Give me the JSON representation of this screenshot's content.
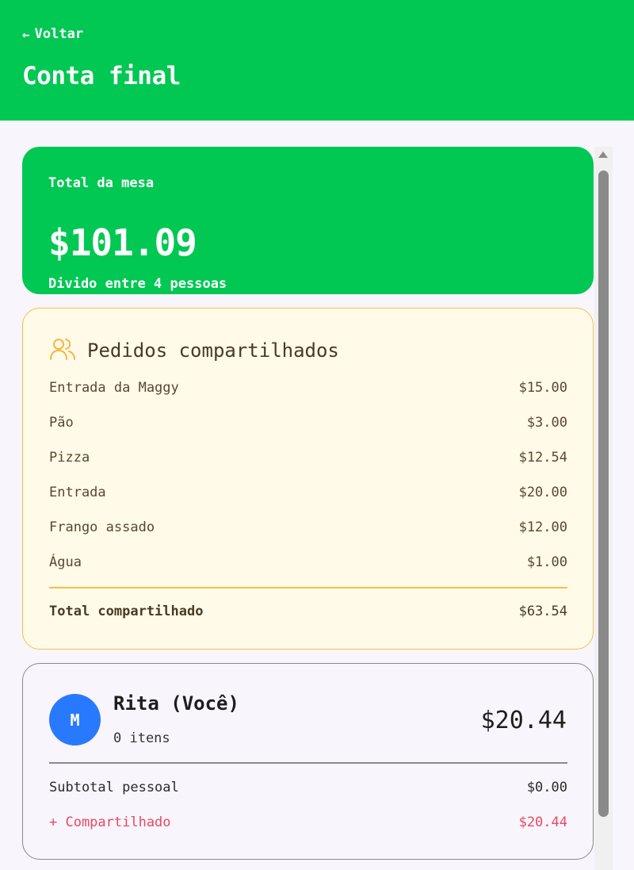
{
  "header": {
    "back_label": "Voltar",
    "title": "Conta final"
  },
  "table_total": {
    "label": "Total da mesa",
    "amount": "$101.09",
    "split_text": "Divido entre 4 pessoas"
  },
  "shared_orders": {
    "title": "Pedidos compartilhados",
    "icon": "users-icon",
    "items": [
      {
        "name": "Entrada da Maggy",
        "price": "$15.00"
      },
      {
        "name": "Pão",
        "price": "$3.00"
      },
      {
        "name": "Pizza",
        "price": "$12.54"
      },
      {
        "name": "Entrada",
        "price": "$20.00"
      },
      {
        "name": "Frango assado",
        "price": "$12.00"
      },
      {
        "name": "Água",
        "price": "$1.00"
      }
    ],
    "total_label": "Total compartilhado",
    "total_value": "$63.54"
  },
  "person": {
    "avatar_initial": "M",
    "name": "Rita (Você)",
    "items_count": "0 itens",
    "total": "$20.44",
    "subtotal_label": "Subtotal pessoal",
    "subtotal_value": "$0.00",
    "shared_label": "+ Compartilhado",
    "shared_value": "$20.44"
  },
  "colors": {
    "brand_green": "#00c853",
    "shared_border": "#f5c04a",
    "avatar_blue": "#2979ff",
    "shared_accent": "#e84a5f"
  }
}
